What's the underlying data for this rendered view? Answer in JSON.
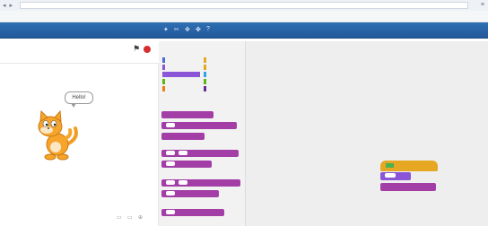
{
  "colors": {
    "menubar": "#2a64a8",
    "looks_block": "#8a55d7",
    "looks_block_dark": "#a23ea6",
    "events_block": "#e6a823",
    "stop": "#d62d2d",
    "script_area": "#eeeeee",
    "palette": "#f2f2f2"
  },
  "stage": {
    "speech_text": "Hello!"
  },
  "icons": {
    "green_flag": "green-flag-icon",
    "stop": "stop-icon"
  }
}
